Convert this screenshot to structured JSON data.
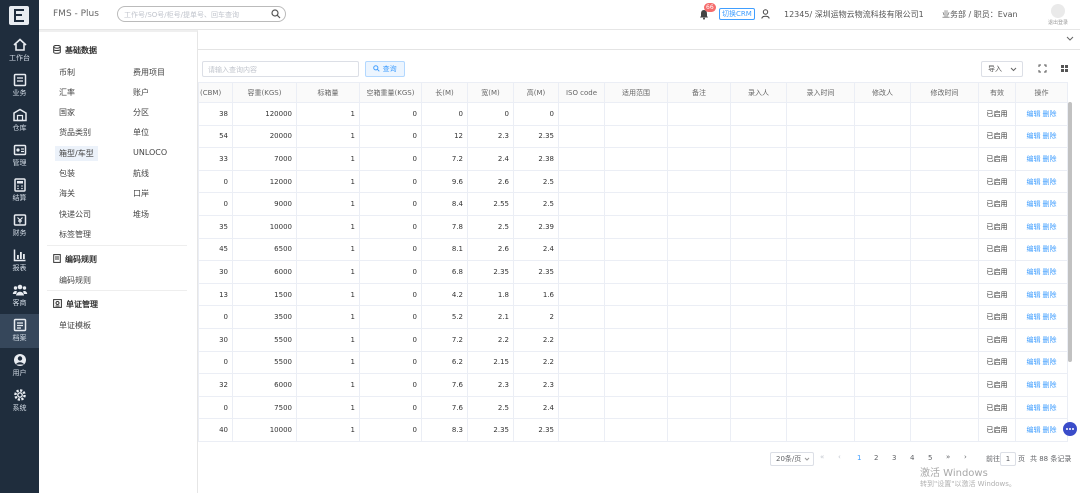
{
  "app": {
    "title": "FMS - Plus"
  },
  "header": {
    "search_placeholder": "工作号/SO号/柜号/提单号、回车查询",
    "notification_count": "66",
    "crm_button": "切换CRM",
    "company": "12345/ 深圳运物云物流科技有限公司1",
    "role": "业务部 / 职员：Evan",
    "avatar_label": "退出登录"
  },
  "rail": [
    {
      "label": "工作台",
      "icon": "home-icon"
    },
    {
      "label": "业务",
      "icon": "business-icon"
    },
    {
      "label": "仓库",
      "icon": "warehouse-icon"
    },
    {
      "label": "管理",
      "icon": "manage-icon"
    },
    {
      "label": "结算",
      "icon": "calculator-icon"
    },
    {
      "label": "财务",
      "icon": "finance-icon"
    },
    {
      "label": "报表",
      "icon": "report-icon"
    },
    {
      "label": "客商",
      "icon": "customers-icon"
    },
    {
      "label": "档案",
      "icon": "archive-icon"
    },
    {
      "label": "用户",
      "icon": "user-icon"
    },
    {
      "label": "系统",
      "icon": "settings-icon"
    }
  ],
  "sidepanel": {
    "sections": [
      {
        "title": "基础数据",
        "items": [
          "币制",
          "费用项目",
          "汇率",
          "账户",
          "国家",
          "分区",
          "货品类别",
          "单位",
          "箱型/车型",
          "UNLOCO",
          "包装",
          "航线",
          "海关",
          "口岸",
          "快递公司",
          "堆场",
          "标签管理"
        ]
      },
      {
        "title": "编码规则",
        "items": [
          "编码规则"
        ]
      },
      {
        "title": "单证管理",
        "items": [
          "单证模板"
        ]
      }
    ],
    "selected": "箱型/车型"
  },
  "toolbar": {
    "query_placeholder": "请输入查询内容",
    "query_button": "查询",
    "import_button": "导入"
  },
  "table": {
    "columns": [
      "(CBM)",
      "容重(KGS)",
      "标箱量",
      "空箱重量(KGS)",
      "长(M)",
      "宽(M)",
      "高(M)",
      "ISO code",
      "适用范围",
      "备注",
      "录入人",
      "录入时间",
      "修改人",
      "修改时间",
      "有效",
      "操作"
    ],
    "status_label": "已启用",
    "edit_label": "编辑",
    "delete_label": "删除",
    "rows": [
      [
        "38",
        "120000",
        "1",
        "0",
        "0",
        "0",
        "0"
      ],
      [
        "54",
        "20000",
        "1",
        "0",
        "12",
        "2.3",
        "2.35"
      ],
      [
        "33",
        "7000",
        "1",
        "0",
        "7.2",
        "2.4",
        "2.38"
      ],
      [
        "0",
        "12000",
        "1",
        "0",
        "9.6",
        "2.6",
        "2.5"
      ],
      [
        "0",
        "9000",
        "1",
        "0",
        "8.4",
        "2.55",
        "2.5"
      ],
      [
        "35",
        "10000",
        "1",
        "0",
        "7.8",
        "2.5",
        "2.39"
      ],
      [
        "45",
        "6500",
        "1",
        "0",
        "8.1",
        "2.6",
        "2.4"
      ],
      [
        "30",
        "6000",
        "1",
        "0",
        "6.8",
        "2.35",
        "2.35"
      ],
      [
        "13",
        "1500",
        "1",
        "0",
        "4.2",
        "1.8",
        "1.6"
      ],
      [
        "0",
        "3500",
        "1",
        "0",
        "5.2",
        "2.1",
        "2"
      ],
      [
        "30",
        "5500",
        "1",
        "0",
        "7.2",
        "2.2",
        "2.2"
      ],
      [
        "0",
        "5500",
        "1",
        "0",
        "6.2",
        "2.15",
        "2.2"
      ],
      [
        "32",
        "6000",
        "1",
        "0",
        "7.6",
        "2.3",
        "2.3"
      ],
      [
        "0",
        "7500",
        "1",
        "0",
        "7.6",
        "2.5",
        "2.4"
      ],
      [
        "40",
        "10000",
        "1",
        "0",
        "8.3",
        "2.35",
        "2.35"
      ]
    ]
  },
  "pagination": {
    "page_size": "20条/页",
    "pages": [
      "1",
      "2",
      "3",
      "4",
      "5"
    ],
    "current": "1",
    "goto_label": "前往",
    "goto_value": "1",
    "page_word": "页",
    "total": "共 88 条记录"
  },
  "watermark": {
    "title": "激活 Windows",
    "subtitle": "转到\"设置\"以激活 Windows。"
  },
  "colors": {
    "rail_bg": "#1f2d3d",
    "accent": "#409eff",
    "selected_bg": "#ecf2fa"
  }
}
